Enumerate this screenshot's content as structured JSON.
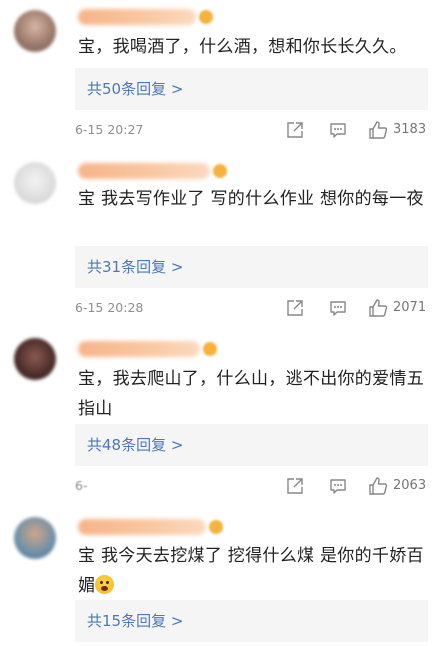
{
  "comments": [
    {
      "text": "宝，我喝酒了，什么酒，想和你长长久久。",
      "reply_label": "共50条回复 >",
      "timestamp": "6-15 20:27",
      "likes": "3183"
    },
    {
      "text": "宝 我去写作业了 写的什么作业 想你的每一夜",
      "reply_label": "共31条回复 >",
      "timestamp": "6-15 20:28",
      "likes": "2071"
    },
    {
      "text": "宝，我去爬山了，什么山，逃不出你的爱情五指山",
      "reply_label": "共48条回复 >",
      "timestamp": "6-",
      "likes": "2063"
    },
    {
      "text": "宝 我今天去挖煤了 挖得什么煤 是你的千娇百媚",
      "emoji": "fearful-face-emoji",
      "reply_label": "共15条回复 >"
    }
  ],
  "icons": {
    "share": "share-icon",
    "comment": "comment-icon",
    "like": "thumbs-up-icon"
  },
  "colors": {
    "reply_link": "#4d77b8",
    "meta_text": "#8f8f8f",
    "reply_bg": "#f5f5f5"
  }
}
